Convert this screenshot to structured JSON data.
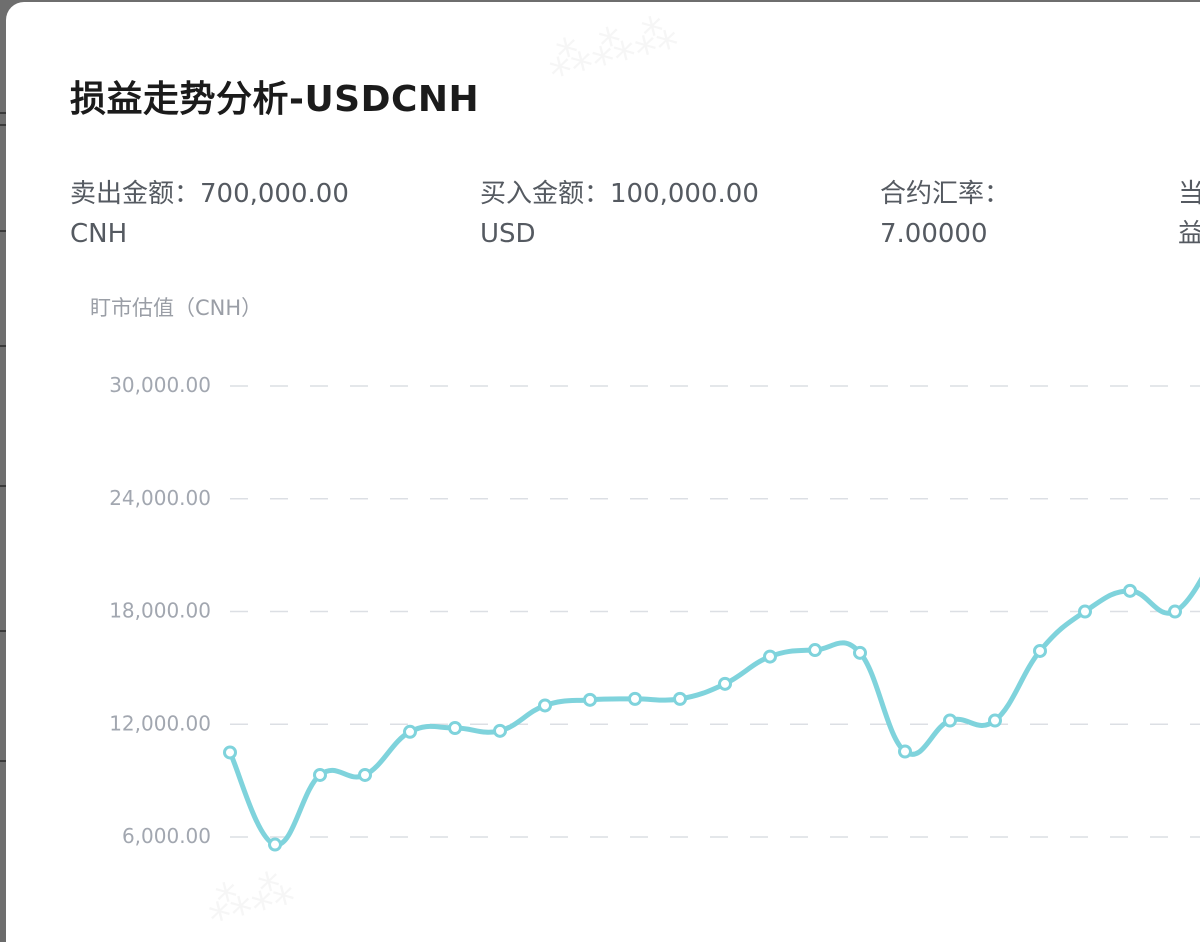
{
  "dialog": {
    "title": "损益走势分析-USDCNH",
    "info": [
      {
        "line1": "卖出金额：700,000.00",
        "line2": "CNH"
      },
      {
        "line1": "买入金额：100,000.00",
        "line2": "USD"
      },
      {
        "line1": "合约汇率：",
        "line2": "7.00000"
      },
      {
        "line1": "当",
        "line2": "益"
      }
    ]
  },
  "chart_data": {
    "type": "line",
    "ylabel": "盯市估值（CNH）",
    "y_ticks": [
      6000,
      12000,
      18000,
      24000,
      30000
    ],
    "y_tick_labels": [
      "6,000.00",
      "12,000.00",
      "18,000.00",
      "24,000.00",
      "30,000.00"
    ],
    "ylim": [
      0,
      30000
    ],
    "grid": true,
    "line_color": "#7fd3dc",
    "series": [
      {
        "values": [
          10500,
          5600,
          9300,
          9300,
          11600,
          11800,
          11650,
          13000,
          13300,
          13350,
          13350,
          14150,
          15600,
          15950,
          15800,
          10550,
          12200,
          12200,
          15900,
          18000,
          19100,
          18000,
          21500
        ]
      }
    ]
  }
}
